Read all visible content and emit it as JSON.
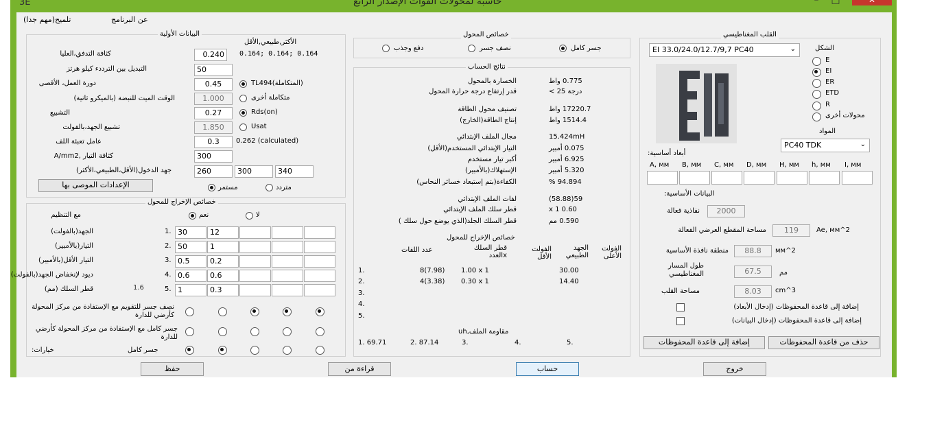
{
  "window": {
    "title": "حاسبة لمحولات القوات الإصدار الرابع",
    "icon_text": "3E"
  },
  "menu": {
    "about": "عن البرنامج",
    "hint": "تلميح(مهم جدا)"
  },
  "initial": {
    "title": "البيانات الأولية",
    "col_header": "الأكثر,طبيعي,الأقل",
    "flux_label": "كثافة التدفق،العليا",
    "flux_value": "0.240",
    "flux_extra": "0.164; 0.164; 0.164",
    "freq_label": "التبديل بين الترددء كيلو هرتز",
    "freq_value": "50",
    "duty_label": "دورة العمل، الأقصى",
    "duty_value": "0.45",
    "duty_opt": "TL494(المتكاملة)",
    "dead_label": "الوقت الميت للنبضة (بالميكرو ثانية)",
    "dead_value": "1.000",
    "dead_opt": "متكاملة أخرى",
    "sat_label": "التشبيع",
    "sat_value": "0.27",
    "sat_opt": "Rds(on)",
    "satv_label": "تشبيع الجهد،بالفولت",
    "satv_value": "1.850",
    "satv_opt": "Usat",
    "fill_label": "عامل تعبئة اللف",
    "fill_value": "0.3",
    "fill_calc": "0.262 (calculated)",
    "cur_label": "كثافة التيار ,A/mm2",
    "cur_value": "300",
    "vin_label": "جهد الدخول(الأقل،الطبيعي،الأكثر)",
    "vin_values": [
      "260",
      "300",
      "340"
    ],
    "recommended_btn": "الإعدادات الموصى بها",
    "cont_opt": "مستمر",
    "var_opt": "متردد"
  },
  "output": {
    "title": "خصائص الإخراج للمحول",
    "reg_label": "مع التنظيم",
    "yes_opt": "نعم",
    "no_opt": "لا",
    "rows": [
      {
        "label": "الجهد(بالفولت)",
        "num": "1.",
        "cells": [
          "30",
          "12",
          "",
          "",
          ""
        ]
      },
      {
        "label": "التيار(بالأمبير)",
        "num": "2.",
        "cells": [
          "50",
          "1",
          "",
          "",
          ""
        ]
      },
      {
        "label": "التيار الأقل(بالأمبير)",
        "num": "3.",
        "cells": [
          "0.5",
          "0.2",
          "",
          "",
          ""
        ]
      },
      {
        "label": "ديود لإنخفاض الجهد(بالفولت)",
        "num": "4.",
        "cells": [
          "0.6",
          "0.6",
          "",
          "",
          ""
        ]
      },
      {
        "label": "قطر السلك  (مم)",
        "num": "5.",
        "cells": [
          "1",
          "0.3",
          "",
          "",
          ""
        ]
      }
    ],
    "wire_prefix": "1.6",
    "opt1": "نصف جسر للتقويم مع الإستفادة من مركز المحولة كأرضي للدارة",
    "opt2": "جسر كامل مع الإستفادة من مركز المحولة كأرضي للدارة",
    "opt3": "جسر كامل",
    "options_label": ":خيارات"
  },
  "conv": {
    "title": "خصائص المحول",
    "full": "جسر كامل",
    "half": "نصف جسر",
    "push": "دفع وجذب"
  },
  "results": {
    "title": "نتائج الحساب",
    "rows": [
      {
        "label": "الخسارة بالمحول",
        "value": "0.775 واط"
      },
      {
        "label": "قدر إرتفاع درجة حرارة المحول",
        "value": "درجة  25 >"
      },
      {
        "label": "تصنيف محول الطاقة",
        "value": "17220.7 واط"
      },
      {
        "label": "إنتاج الطاقة(الخارج)",
        "value": "1514.4 واط"
      },
      {
        "label": "مجال الملف الإبتدائي",
        "value": "15.424mH"
      },
      {
        "label": "التيار الإبتدائي المستخدم(الأقل)",
        "value": "0.075 أمبير"
      },
      {
        "label": "أكبر تيار مستخدم",
        "value": "6.925 أمبير"
      },
      {
        "label": "الإستهلاك(بالأمبير)",
        "value": "5.320 أمبير"
      },
      {
        "label": "الكفاءة(بتم إستبعاد خسائر النحاس)",
        "value": "94.894 %"
      },
      {
        "label": "لفات الملف الإبتدائي",
        "value": "59(58.88)"
      },
      {
        "label": "قطر سلك الملف الإبتدائي",
        "value": "0.60 x 1"
      },
      {
        "label": "قطر السلك الجلد(الذي يوضع حول سلك )",
        "value": "0.590 مم"
      }
    ],
    "out_title": "خصائص الإخراج للمحول",
    "hdr_vhigh": "الفولت الأعلى",
    "hdr_vnom": "الجهد الطبيعي",
    "hdr_vlow": "الفولت الأقل",
    "hdr_wire": "قطر السلك xالعدد",
    "hdr_turns": "عدد اللفات",
    "out_rows": [
      {
        "num": "1.",
        "turns": "8(7.98)",
        "wire": "1.00 x 1",
        "vnom": "30.00"
      },
      {
        "num": "2.",
        "turns": "4(3.38)",
        "wire": "0.30 x 1",
        "vnom": "14.40"
      },
      {
        "num": "3.",
        "turns": "",
        "wire": "",
        "vnom": ""
      },
      {
        "num": "4.",
        "turns": "",
        "wire": "",
        "vnom": ""
      },
      {
        "num": "5.",
        "turns": "",
        "wire": "",
        "vnom": ""
      }
    ],
    "res_title": "مقاومة الملف,uh",
    "res_values": [
      "1. 69.71",
      "2. 87.14",
      "3.",
      "4.",
      "5."
    ]
  },
  "core": {
    "title": "القلب المغناطيسي",
    "shape_label": "الشكل",
    "core_select": "EI 33.0/24.0/12.7/9,7 PC40",
    "shapes": [
      "E",
      "EI",
      "ER",
      "ETD",
      "R",
      "محولات أخرى"
    ],
    "material_label": "المواد",
    "material_select": "PC40 TDK",
    "dims_title": "أبعاد أساسية:",
    "dims": [
      "A, мм",
      "B, мм",
      "C, мм",
      "D, мм",
      "H, мм",
      "h, мм",
      "I, мм"
    ],
    "basic_title": "البيانات الأساسية:",
    "perm_label": "نفاذية فعالة",
    "perm_value": "2000",
    "ae_label": "مساحة المقطع العرضي الفعالة",
    "ae_value": "119",
    "ae_unit": "Ae, мм^2",
    "win_label": "منطقة نافذة الأساسية",
    "win_value": "88.8",
    "win_unit": "мм^2",
    "path_label": "طول المسار المغناطيسي",
    "path_value": "67.5",
    "path_unit": "مم",
    "vol_label": "مساحة القلب",
    "vol_value": "8.03",
    "vol_unit": "cm^3",
    "chk1": "إضافة إلى قاعدة المحفوظات (إدخال الأبعاد)",
    "chk2": "إضافة إلى قاعدة المحفوظات (إدخال البيانات)",
    "del_btn": "حذف من قاعدة المحفوظات",
    "add_btn": "إضافة إلى قاعدة المحفوظات"
  },
  "bottom": {
    "save": "حفظ",
    "read": "قراءة من",
    "calc": "حساب",
    "exit": "خروج"
  }
}
